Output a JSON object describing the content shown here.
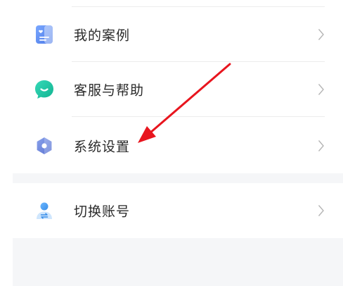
{
  "menu": {
    "items": [
      {
        "label": "我的案例",
        "icon": "case-folder-icon"
      },
      {
        "label": "客服与帮助",
        "icon": "chat-bubble-icon"
      },
      {
        "label": "系统设置",
        "icon": "hexagon-settings-icon"
      }
    ],
    "account": {
      "label": "切换账号",
      "icon": "switch-user-icon"
    }
  },
  "colors": {
    "case_icon": "#5b8ff0",
    "help_icon": "#1fc6a3",
    "settings_icon": "#6f86d8",
    "account_icon": "#4ea3ef",
    "annotation_arrow": "#e8151e",
    "gap_background": "#f5f6f8"
  }
}
